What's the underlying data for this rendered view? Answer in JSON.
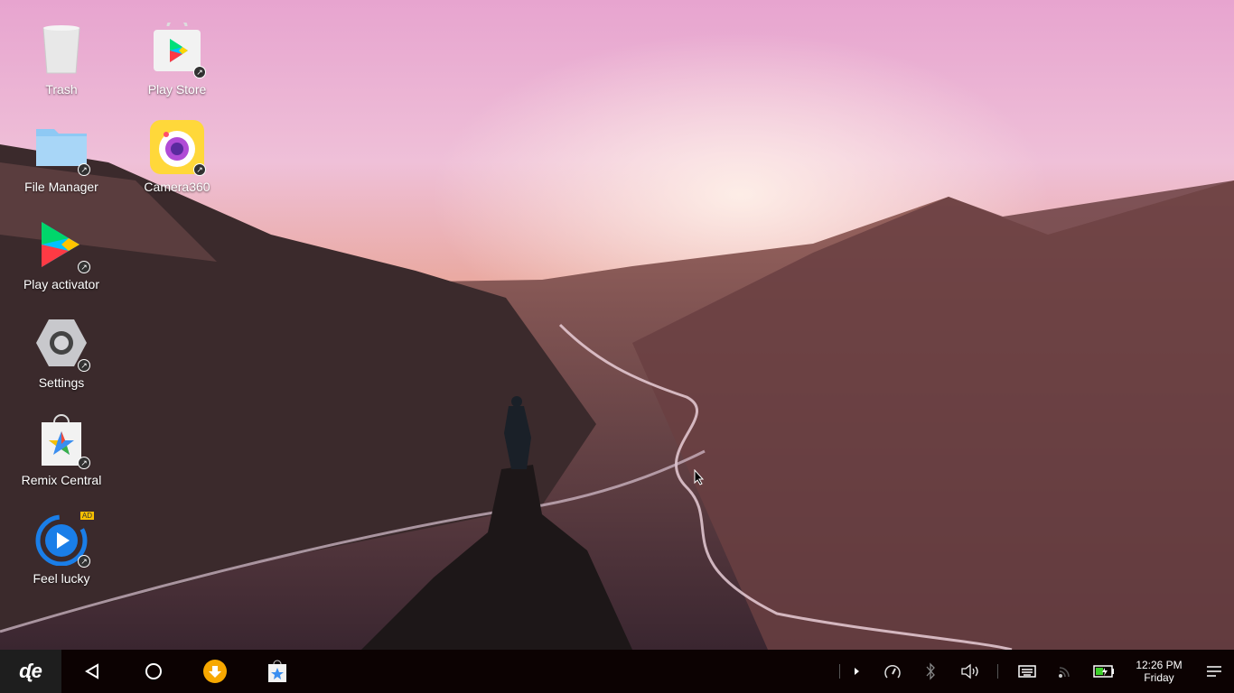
{
  "desktop": {
    "icons": [
      {
        "label": "Trash",
        "icon": "trash-icon"
      },
      {
        "label": "Play Store",
        "icon": "play-store-icon"
      },
      {
        "label": "File Manager",
        "icon": "folder-icon"
      },
      {
        "label": "Camera360",
        "icon": "camera-icon"
      },
      {
        "label": "Play activator",
        "icon": "play-activator-icon"
      },
      {
        "label": "Settings",
        "icon": "gear-icon"
      },
      {
        "label": "Remix Central",
        "icon": "remix-central-icon"
      },
      {
        "label": "Feel lucky",
        "icon": "feel-lucky-icon",
        "badge": "AD"
      }
    ]
  },
  "taskbar": {
    "clock": {
      "time": "12:26 PM",
      "day": "Friday"
    },
    "battery_level": 0.5,
    "colors": {
      "download": "#f7a800",
      "battery": "#3ecf2b",
      "bar": "#0c0202"
    }
  }
}
